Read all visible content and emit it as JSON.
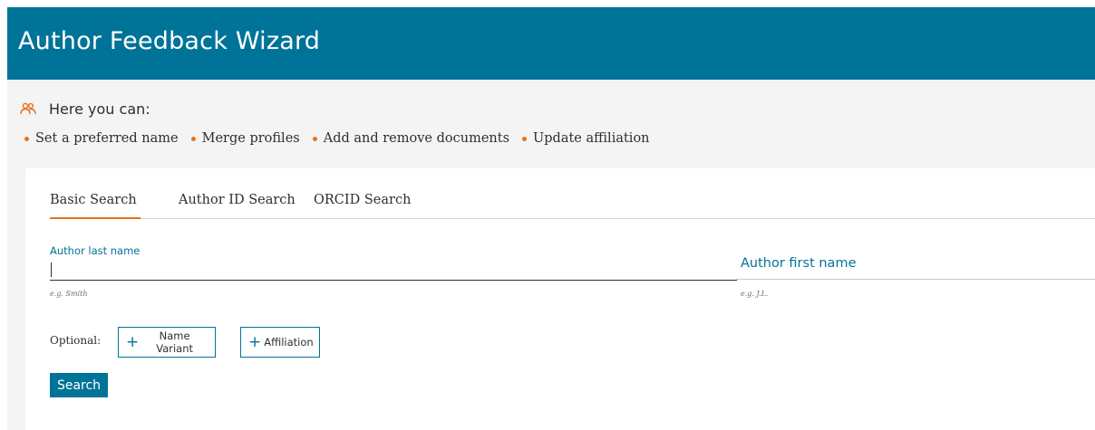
{
  "header": {
    "title": "Author Feedback Wizard"
  },
  "intro": {
    "icon": "users-icon",
    "heading": "Here you can:",
    "features": [
      "Set a preferred name",
      "Merge profiles",
      "Add and remove documents",
      "Update affiliation"
    ]
  },
  "tabs": [
    {
      "label": "Basic Search",
      "active": true
    },
    {
      "label": "Author ID Search",
      "active": false
    },
    {
      "label": "ORCID Search",
      "active": false
    }
  ],
  "form": {
    "last_name": {
      "label": "Author last name",
      "value": "",
      "hint": "e.g. Smith"
    },
    "first_name": {
      "label": "Author first name",
      "value": "",
      "hint": "e.g. J.L."
    },
    "optional_label": "Optional:",
    "optional_buttons": [
      {
        "label": "Name Variant",
        "icon": "plus-icon"
      },
      {
        "label": "Affiliation",
        "icon": "plus-icon"
      }
    ],
    "search_label": "Search"
  },
  "colors": {
    "brand": "#007398",
    "accent": "#e9711c",
    "background": "#f4f4f4"
  }
}
